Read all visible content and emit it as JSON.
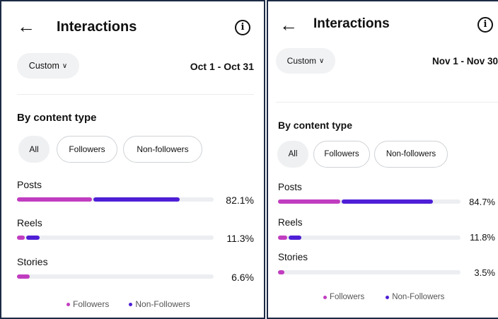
{
  "colors": {
    "followers": "#c13dc0",
    "non_followers": "#4e1fd6",
    "track": "#eceef1"
  },
  "panels": [
    {
      "header": {
        "back_icon": "arrow-left-icon",
        "title": "Interactions",
        "info_icon": "info-icon"
      },
      "filter": {
        "custom_label": "Custom",
        "chevron_icon": "chevron-down-icon",
        "date_range": "Oct 1 - Oct 31"
      },
      "section_title": "By content type",
      "pills": [
        "All",
        "Followers",
        "Non-followers"
      ],
      "rows": [
        {
          "label": "Posts",
          "percent": "82.1%",
          "followers_frac": 0.38,
          "non_followers_frac": 0.44
        },
        {
          "label": "Reels",
          "percent": "11.3%",
          "followers_frac": 0.04,
          "non_followers_frac": 0.07
        },
        {
          "label": "Stories",
          "percent": "6.6%",
          "followers_frac": 0.066,
          "non_followers_frac": 0
        }
      ],
      "legend": {
        "followers": "Followers",
        "non_followers": "Non-Followers"
      }
    },
    {
      "header": {
        "back_icon": "arrow-left-icon",
        "title": "Interactions",
        "info_icon": "info-icon"
      },
      "filter": {
        "custom_label": "Custom",
        "chevron_icon": "chevron-down-icon",
        "date_range": "Nov 1 - Nov 30"
      },
      "section_title": "By content type",
      "pills": [
        "All",
        "Followers",
        "Non-followers"
      ],
      "rows": [
        {
          "label": "Posts",
          "percent": "84.7%",
          "followers_frac": 0.34,
          "non_followers_frac": 0.5
        },
        {
          "label": "Reels",
          "percent": "11.8%",
          "followers_frac": 0.05,
          "non_followers_frac": 0.07
        },
        {
          "label": "Stories",
          "percent": "3.5%",
          "followers_frac": 0.035,
          "non_followers_frac": 0
        }
      ],
      "legend": {
        "followers": "Followers",
        "non_followers": "Non-Followers"
      }
    }
  ]
}
